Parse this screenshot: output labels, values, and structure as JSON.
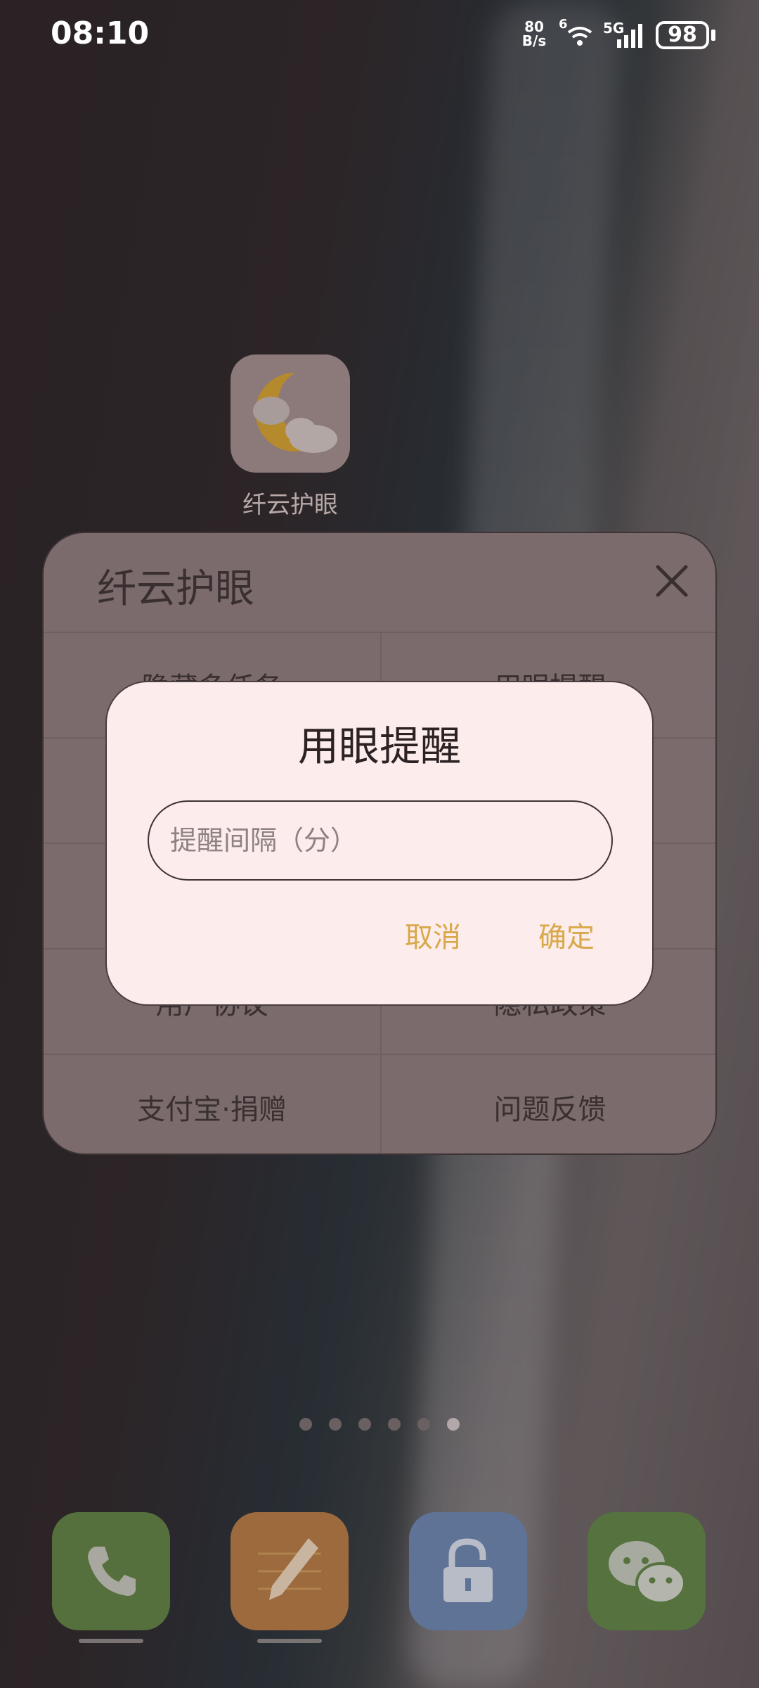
{
  "status_bar": {
    "time": "08:10",
    "net_speed_value": "80",
    "net_speed_unit": "B/s",
    "sim_slot": "6",
    "network": "5G",
    "battery": "98"
  },
  "home": {
    "app_label": "纤云护眼",
    "page_count": 6,
    "active_page": 6
  },
  "menu": {
    "title": "纤云护眼",
    "rows": [
      [
        "隐藏多任务",
        "用眼提醒"
      ],
      [
        "",
        ""
      ],
      [
        "",
        ""
      ],
      [
        "用户协议",
        "隐私政策"
      ],
      [
        "支付宝·捐赠",
        "问题反馈"
      ]
    ]
  },
  "dialog": {
    "title": "用眼提醒",
    "input_placeholder": "提醒间隔（分）",
    "input_value": "",
    "cancel_label": "取消",
    "confirm_label": "确定",
    "accent_color": "#d8a84a"
  },
  "dock": {
    "apps": [
      "phone-icon",
      "notes-icon",
      "lock-icon",
      "wechat-icon"
    ]
  }
}
